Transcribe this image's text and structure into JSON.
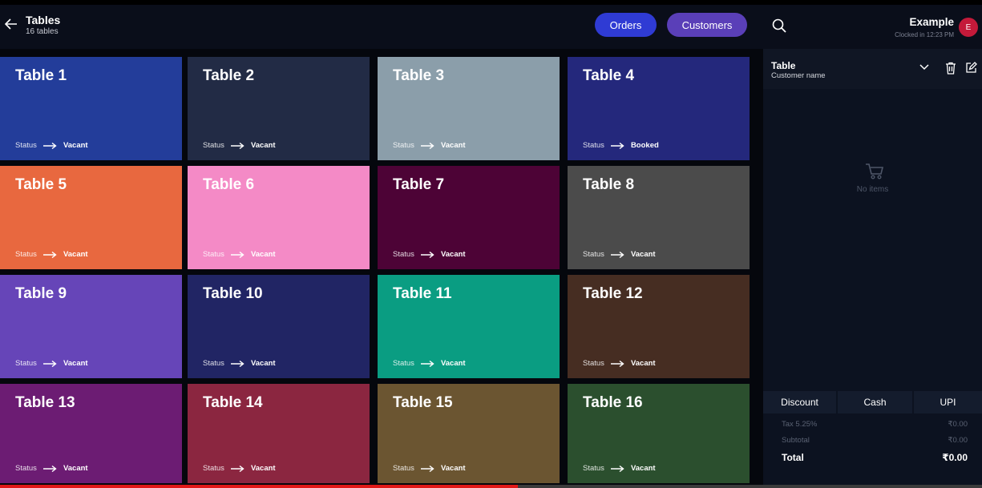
{
  "header": {
    "title": "Tables",
    "subtitle": "16 tables",
    "orders_label": "Orders",
    "customers_label": "Customers"
  },
  "tables": [
    {
      "name": "Table 1",
      "status_label": "Status",
      "status": "Vacant",
      "color": "#233d9a"
    },
    {
      "name": "Table 2",
      "status_label": "Status",
      "status": "Vacant",
      "color": "#222b45"
    },
    {
      "name": "Table 3",
      "status_label": "Status",
      "status": "Vacant",
      "color": "#8b9eaa"
    },
    {
      "name": "Table 4",
      "status_label": "Status",
      "status": "Booked",
      "color": "#24287c"
    },
    {
      "name": "Table 5",
      "status_label": "Status",
      "status": "Vacant",
      "color": "#e8683f"
    },
    {
      "name": "Table 6",
      "status_label": "Status",
      "status": "Vacant",
      "color": "#f48ac6"
    },
    {
      "name": "Table 7",
      "status_label": "Status",
      "status": "Vacant",
      "color": "#4d0336"
    },
    {
      "name": "Table 8",
      "status_label": "Status",
      "status": "Vacant",
      "color": "#4b4b4b"
    },
    {
      "name": "Table 9",
      "status_label": "Status",
      "status": "Vacant",
      "color": "#6645b8"
    },
    {
      "name": "Table 10",
      "status_label": "Status",
      "status": "Vacant",
      "color": "#212564"
    },
    {
      "name": "Table 11",
      "status_label": "Status",
      "status": "Vacant",
      "color": "#0a9d82"
    },
    {
      "name": "Table 12",
      "status_label": "Status",
      "status": "Vacant",
      "color": "#462d22"
    },
    {
      "name": "Table 13",
      "status_label": "Status",
      "status": "Vacant",
      "color": "#6c1c73"
    },
    {
      "name": "Table 14",
      "status_label": "Status",
      "status": "Vacant",
      "color": "#8b2640"
    },
    {
      "name": "Table 15",
      "status_label": "Status",
      "status": "Vacant",
      "color": "#6b5531"
    },
    {
      "name": "Table 16",
      "status_label": "Status",
      "status": "Vacant",
      "color": "#2b4f2e"
    }
  ],
  "user": {
    "name": "Example",
    "clocked": "Clocked in 12:23 PM",
    "avatar_initial": "E",
    "avatar_color": "#c41a3a"
  },
  "order": {
    "table_label": "Table",
    "customer_label": "Customer name",
    "empty_text": "No items",
    "payment": [
      "Discount",
      "Cash",
      "UPI"
    ],
    "summary": [
      {
        "label": "Tax 5.25%",
        "value": "₹0.00"
      },
      {
        "label": "Subtotal",
        "value": "₹0.00"
      }
    ],
    "total": {
      "label": "Total",
      "value": "₹0.00"
    }
  },
  "video": {
    "progress": 0.527
  }
}
